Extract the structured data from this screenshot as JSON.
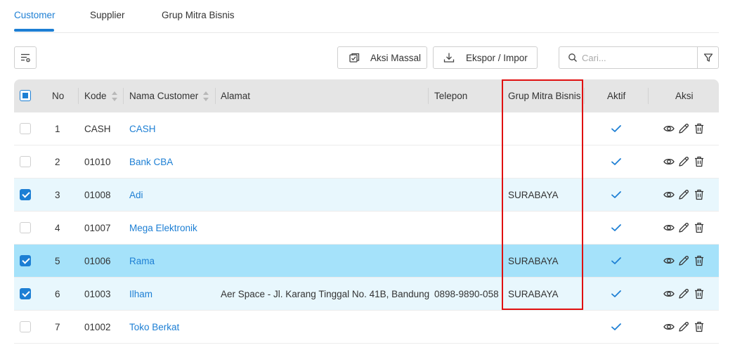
{
  "tabs": [
    {
      "label": "Customer",
      "active": true
    },
    {
      "label": "Supplier",
      "active": false
    },
    {
      "label": "Grup Mitra Bisnis",
      "active": false
    }
  ],
  "toolbar": {
    "settings_icon": "column-settings-icon",
    "bulk_action_label": "Aksi Massal",
    "export_import_label": "Ekspor / Impor",
    "search_placeholder": "Cari...",
    "filter_icon": "filter-icon"
  },
  "table": {
    "columns": {
      "select": "",
      "no": "No",
      "kode": "Kode",
      "nama": "Nama Customer",
      "alamat": "Alamat",
      "telepon": "Telepon",
      "grup": "Grup Mitra Bisnis",
      "aktif": "Aktif",
      "aksi": "Aksi"
    },
    "rows": [
      {
        "no": "1",
        "kode": "CASH",
        "nama": "CASH",
        "alamat": "",
        "telepon": "",
        "grup": "",
        "aktif": true,
        "checked": false,
        "state": "normal"
      },
      {
        "no": "2",
        "kode": "01010",
        "nama": "Bank CBA",
        "alamat": "",
        "telepon": "",
        "grup": "",
        "aktif": true,
        "checked": false,
        "state": "normal"
      },
      {
        "no": "3",
        "kode": "01008",
        "nama": "Adi",
        "alamat": "",
        "telepon": "",
        "grup": "SURABAYA",
        "aktif": true,
        "checked": true,
        "state": "selected"
      },
      {
        "no": "4",
        "kode": "01007",
        "nama": "Mega Elektronik",
        "alamat": "",
        "telepon": "",
        "grup": "",
        "aktif": true,
        "checked": false,
        "state": "normal"
      },
      {
        "no": "5",
        "kode": "01006",
        "nama": "Rama",
        "alamat": "",
        "telepon": "",
        "grup": "SURABAYA",
        "aktif": true,
        "checked": true,
        "state": "highlighted"
      },
      {
        "no": "6",
        "kode": "01003",
        "nama": "Ilham",
        "alamat": "Aer Space - Jl. Karang Tinggal No. 41B, Bandung",
        "telepon": "0898-9890-058",
        "grup": "SURABAYA",
        "aktif": true,
        "checked": true,
        "state": "selected"
      },
      {
        "no": "7",
        "kode": "01002",
        "nama": "Toko Berkat",
        "alamat": "",
        "telepon": "",
        "grup": "",
        "aktif": true,
        "checked": false,
        "state": "normal"
      }
    ]
  },
  "colors": {
    "accent": "#1d7fd4",
    "header_bg": "#e5e5e5",
    "row_selected": "#e8f7fd",
    "row_highlight": "#a5e2fa",
    "check_green": "#1d7fd4",
    "annotation_red": "#e01010"
  }
}
